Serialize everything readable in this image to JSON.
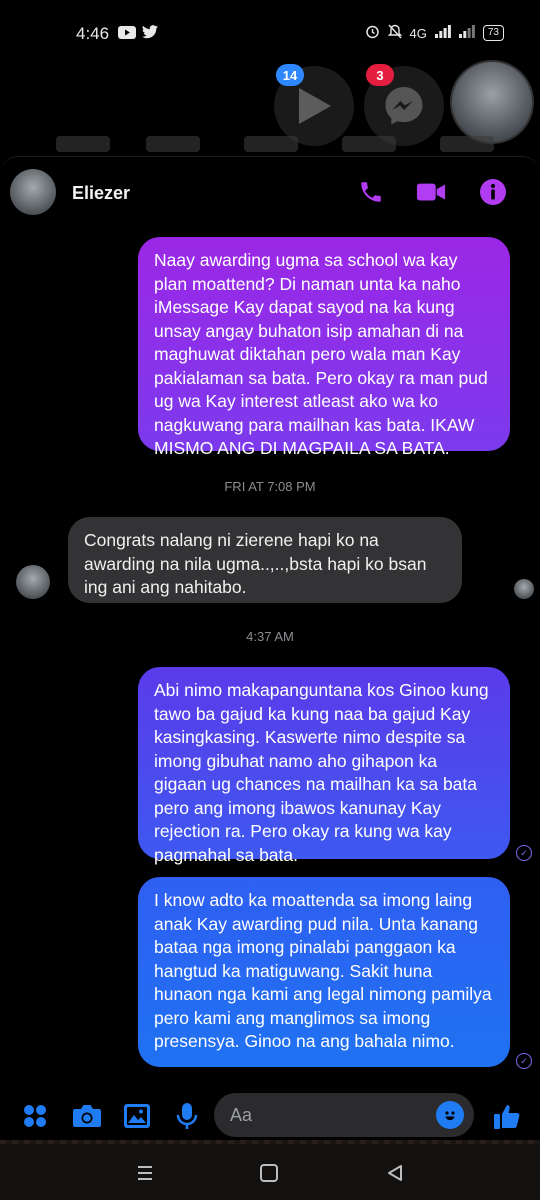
{
  "status_bar": {
    "time": "4:46",
    "network": "4G",
    "battery": "73",
    "icons": [
      "youtube-icon",
      "twitter-icon",
      "alarm-icon",
      "mute-icon",
      "signal-icon",
      "battery-icon"
    ]
  },
  "chat_heads": {
    "youtube_badge": "14",
    "messenger_badge": "3"
  },
  "header": {
    "name": "Eliezer"
  },
  "messages": [
    {
      "direction": "outgoing",
      "text": "Naay awarding ugma sa school wa kay plan moattend? Di naman unta ka naho iMessage Kay dapat sayod na ka kung unsay angay buhaton isip amahan di na maghuwat diktahan pero wala man Kay pakialaman sa bata. Pero okay ra man pud ug wa Kay interest atleast ako wa ko nagkuwang para mailhan kas bata. IKAW MISMO ANG DI MAGPAILA SA BATA."
    },
    {
      "direction": "incoming",
      "text": "Congrats nalang ni zierene hapi ko na awarding na nila ugma..,..,bsta hapi ko bsan ing ani ang nahitabo."
    },
    {
      "direction": "outgoing",
      "text": "Abi nimo makapanguntana kos Ginoo kung tawo ba gajud ka kung naa ba gajud Kay kasingkasing. Kaswerte nimo despite sa imong gibuhat namo aho gihapon ka gigaan ug chances na mailhan ka sa bata pero ang imong ibawos kanunay Kay rejection ra. Pero okay ra kung wa kay pagmahal sa bata."
    },
    {
      "direction": "outgoing",
      "text": "I know adto ka moattenda sa imong laing anak Kay awarding pud nila. Unta kanang bataa nga imong pinalabi panggaon ka hangtud ka matiguwang. Sakit huna hunaon nga kami ang legal nimong pamilya pero kami ang manglimos sa imong presensya. Ginoo na ang bahala nimo."
    }
  ],
  "timestamps": {
    "first": "FRI AT 7:08 PM",
    "second": "4:37 AM"
  },
  "composer": {
    "placeholder": "Aa"
  },
  "colors": {
    "bubble_purple": "#9b27e6",
    "bubble_indigo": "#5b3bea",
    "bubble_blue": "#1f72f2",
    "header_icons": "#b13cf2",
    "composer_icons": "#1f7cf2"
  }
}
